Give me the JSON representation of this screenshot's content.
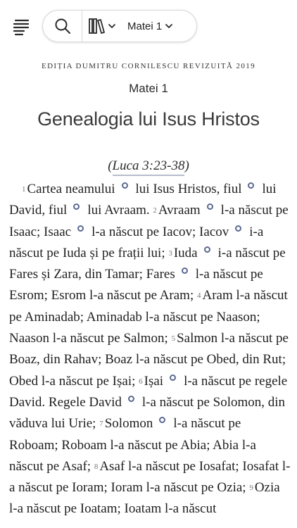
{
  "toolbar": {
    "menu_icon": "menu-lines-icon",
    "search_icon": "search-icon",
    "library_icon": "books-icon",
    "chapter_label": "Matei 1",
    "dropdown_icon": "chevron-down-icon"
  },
  "header": {
    "edition": "EDIȚIA DUMITRU CORNILESCU REVIZUITĂ 2019",
    "book_chapter": "Matei 1",
    "section_title": "Genealogia lui Isus Hristos"
  },
  "crossref": {
    "open": "(",
    "link": "Luca 3:23-38",
    "close": ")"
  },
  "verses": {
    "v1": {
      "num": "1",
      "a": "Cartea neamului",
      "b": "lui Isus Hristos, fiul",
      "c": "lui David, fiul",
      "d": "lui Avraam."
    },
    "v2": {
      "num": "2",
      "a": "Avraam",
      "b": "l-a născut pe Isaac; Isaac",
      "c": "l-a născut pe Iacov; Iacov",
      "d": "i-a născut pe Iuda și pe frații lui;"
    },
    "v3": {
      "num": "3",
      "a": "Iuda",
      "b": "i-a născut pe Fares și Zara, din Tamar; Fares",
      "c": "l-a născut pe Esrom; Esrom l-a născut pe Aram;"
    },
    "v4": {
      "num": "4",
      "a": "Aram l-a născut pe Aminadab; Aminadab l-a născut pe Naason; Naason l-a născut pe Salmon;"
    },
    "v5": {
      "num": "5",
      "a": "Salmon l-a născut pe Boaz, din Rahav; Boaz l-a născut pe Obed, din Rut; Obed l-a născut pe Ișai;"
    },
    "v6": {
      "num": "6",
      "a": "Ișai",
      "b": "l-a născut pe regele David. Regele David",
      "c": "l-a născut pe Solomon, din văduva lui Urie;"
    },
    "v7": {
      "num": "7",
      "a": "Solomon",
      "b": "l-a născut pe Roboam; Roboam l-a născut pe Abia; Abia l-a născut pe Asaf;"
    },
    "v8": {
      "num": "8",
      "a": "Asaf l-a născut pe Iosafat; Iosafat l-a născut pe Ioram; Ioram l-a născut pe Ozia;"
    },
    "v9": {
      "num": "9",
      "a": "Ozia l-a născut pe Ioatam; Ioatam l-a născut"
    }
  },
  "colors": {
    "note_marker": "#5c6890",
    "link_underline": "#b7bccd"
  }
}
